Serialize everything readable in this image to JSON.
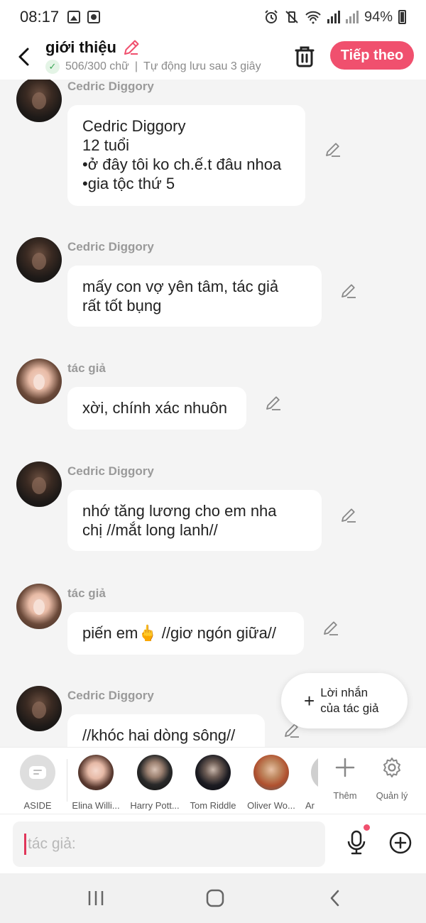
{
  "status_bar": {
    "time": "08:17",
    "battery": "94%"
  },
  "header": {
    "title": "giới thiệu",
    "word_count": "506/300 chữ",
    "separator": "|",
    "autosave": "Tự động lưu sau 3 giây",
    "next_label": "Tiếp theo"
  },
  "messages": [
    {
      "sender": "Cedric Diggory",
      "avatar": "cedric",
      "text": "Cedric Diggory\n12 tuổi\n•ở đây tôi ko ch.ế.t đâu nhoa\n•gia tộc thứ 5"
    },
    {
      "sender": "Cedric Diggory",
      "avatar": "cedric",
      "text": "mấy con vợ yên tâm, tác giả\nrất tốt bụng"
    },
    {
      "sender": "tác giả",
      "avatar": "author",
      "text": "xời, chính xác nhuôn"
    },
    {
      "sender": "Cedric Diggory",
      "avatar": "cedric",
      "text": "nhớ tăng lương cho em nha\nchị //mắt long lanh//"
    },
    {
      "sender": "tác giả",
      "avatar": "author",
      "text": "piến em🖕 //giơ ngón giữa//"
    },
    {
      "sender": "Cedric Diggory",
      "avatar": "cedric",
      "text": "//khóc hai dòng sông//"
    }
  ],
  "author_note": {
    "line1": "Lời nhắn",
    "line2": "của tác giả"
  },
  "characters": [
    {
      "name": "ASIDE"
    },
    {
      "name": "Elina Willi..."
    },
    {
      "name": "Harry Pott..."
    },
    {
      "name": "Tom Riddle"
    },
    {
      "name": "Oliver Wo..."
    },
    {
      "name": "Ar"
    }
  ],
  "char_actions": {
    "add": "Thêm",
    "manage": "Quản lý"
  },
  "input": {
    "placeholder": "tác giả:"
  },
  "colors": {
    "accent": "#f0506e",
    "background": "#f4f4f4",
    "bubble": "#ffffff",
    "sender": "#9a9a9a"
  }
}
